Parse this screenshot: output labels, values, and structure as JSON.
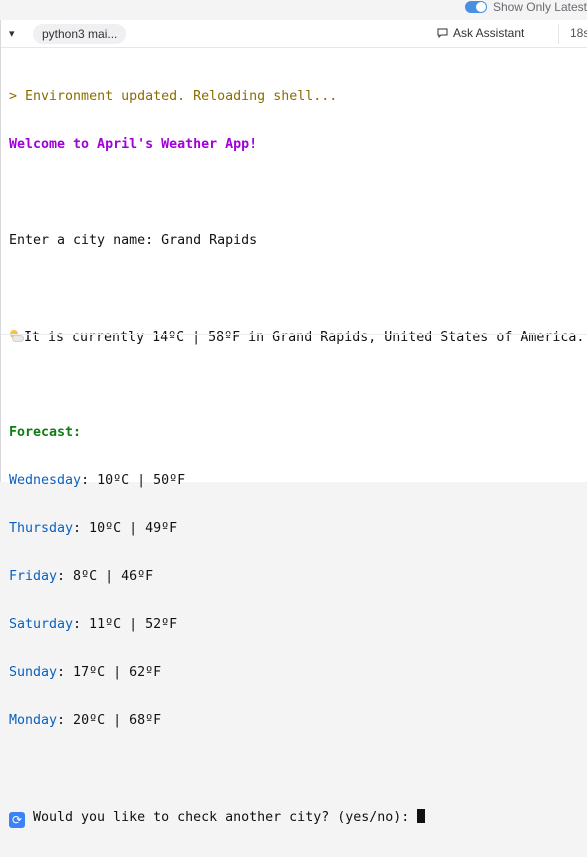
{
  "header": {
    "toggle_label": "Show Only Latest"
  },
  "toolbar": {
    "kernel_label": "python3 mai...",
    "assistant_label": "Ask Assistant",
    "time_label": "18s"
  },
  "terminal": {
    "env_marker": ">",
    "env_text": " Environment updated. Reloading shell...",
    "welcome": "Welcome to April's Weather App!",
    "prompt": "Enter a city name: Grand Rapids",
    "current": "It is currently 14ºC | 58ºF in Grand Rapids, United States of America.",
    "forecast_heading": "Forecast:",
    "forecast": [
      {
        "day": "Wednesday",
        "temps": ": 10ºC | 50ºF"
      },
      {
        "day": "Thursday",
        "temps": ": 10ºC | 49ºF"
      },
      {
        "day": "Friday",
        "temps": ": 8ºC | 46ºF"
      },
      {
        "day": "Saturday",
        "temps": ": 11ºC | 52ºF"
      },
      {
        "day": "Sunday",
        "temps": ": 17ºC | 62ºF"
      },
      {
        "day": "Monday",
        "temps": ": 20ºC | 68ºF"
      }
    ],
    "again_prompt": " Would you like to check another city? (yes/no): "
  },
  "icons": {
    "current": "sun-behind-cloud-icon",
    "again": "repeat-arrows-icon",
    "kernel": "chevron-down-icon",
    "assistant": "chat-bubble-icon"
  },
  "colors": {
    "toggle_on": "#4a90e2",
    "env": "#8a6d00",
    "welcome": "#a100d8",
    "forecast_heading": "#0f7d12",
    "day_names": "#0b5fbf"
  }
}
